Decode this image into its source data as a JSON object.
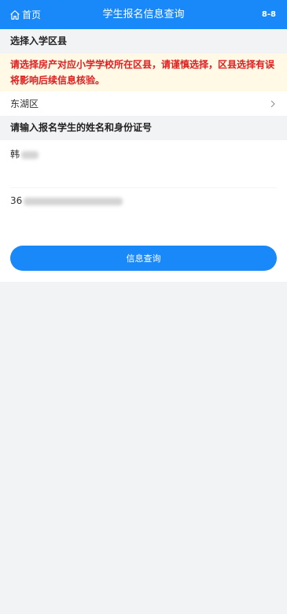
{
  "header": {
    "home_label": "首页",
    "title": "学生报名信息查询",
    "version": "8-8",
    "home_icon": "home-icon",
    "colors": {
      "background": "#1989fa",
      "text": "#ffffff"
    }
  },
  "district_section": {
    "title": "选择入学区县",
    "notice": "请选择房产对应小学学校所在区县，请谨慎选择，区县选择有误将影响后续信息核验。",
    "notice_color": "#e02020",
    "selected_district": "东湖区",
    "arrow_icon": "chevron-right-icon"
  },
  "student_section": {
    "title": "请输入报名学生的姓名和身份证号",
    "name_value": "韩",
    "id_value": "36"
  },
  "actions": {
    "query_label": "信息查询",
    "button_color": "#1989fa"
  }
}
